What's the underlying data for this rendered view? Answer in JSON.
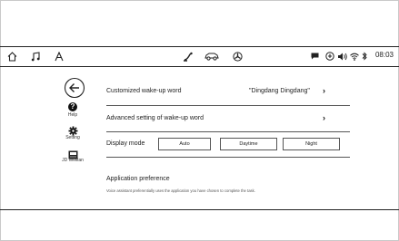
{
  "status_bar": {
    "left_icons": [
      "home-icon",
      "music-note-icon",
      "navigation-a-icon"
    ],
    "center_icons": [
      "steering-icon",
      "car-icon",
      "fan-icon"
    ],
    "right_icons": [
      "message-icon",
      "signal-icon",
      "volume-icon",
      "wifi-icon",
      "bluetooth-icon"
    ],
    "time": "08:03"
  },
  "sidebar": {
    "back_icon": "back-arrow-icon",
    "items": [
      {
        "label": "Help",
        "icon": "help-icon"
      },
      {
        "label": "Setting",
        "icon": "gear-icon"
      },
      {
        "label": "JD Weilian",
        "icon": "jd-weilian-icon"
      }
    ]
  },
  "settings": {
    "wakeup": {
      "title": "Customized wake-up word",
      "value": "\"Dingdang Dingdang\""
    },
    "advanced": {
      "title": "Advanced setting of wake-up word"
    },
    "display_mode": {
      "title": "Display mode",
      "options": [
        "Auto",
        "Daytime",
        "Night"
      ]
    },
    "app_pref": {
      "title": "Application preference",
      "description": "Voice assistant preferentially uses the application you have chosen to complete the task."
    }
  }
}
